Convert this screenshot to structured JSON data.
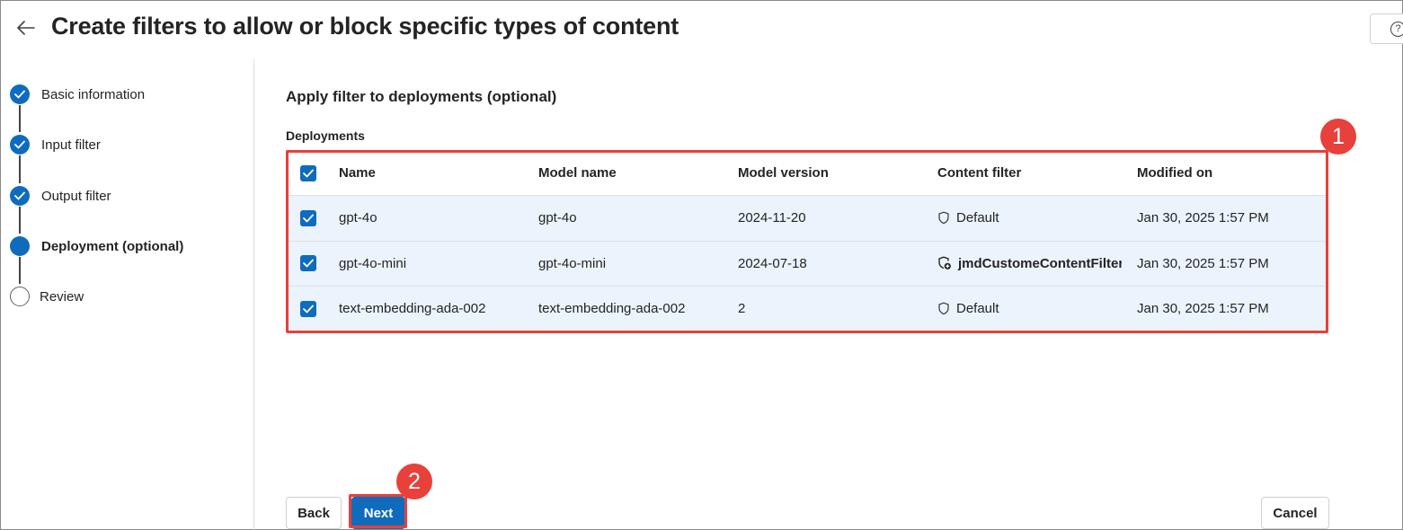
{
  "header": {
    "title": "Create filters to allow or block specific types of content",
    "help_symbol": "?"
  },
  "stepper": {
    "steps": [
      {
        "label": "Basic information",
        "state": "complete"
      },
      {
        "label": "Input filter",
        "state": "complete"
      },
      {
        "label": "Output filter",
        "state": "complete"
      },
      {
        "label": "Deployment (optional)",
        "state": "current"
      },
      {
        "label": "Review",
        "state": "pending"
      }
    ]
  },
  "main": {
    "section_title": "Apply filter to deployments (optional)",
    "table_label": "Deployments",
    "columns": [
      "Name",
      "Model name",
      "Model version",
      "Content filter",
      "Modified on"
    ],
    "rows": [
      {
        "name": "gpt-4o",
        "model": "gpt-4o",
        "version": "2024-11-20",
        "filter": "Default",
        "modified": "Jan 30, 2025 1:57 PM",
        "checked": true
      },
      {
        "name": "gpt-4o-mini",
        "model": "gpt-4o-mini",
        "version": "2024-07-18",
        "filter": "jmdCustomeContentFilter",
        "modified": "Jan 30, 2025 1:57 PM",
        "checked": true
      },
      {
        "name": "text-embedding-ada-002",
        "model": "text-embedding-ada-002",
        "version": "2",
        "filter": "Default",
        "modified": "Jan 30, 2025 1:57 PM",
        "checked": true
      }
    ]
  },
  "annotations": {
    "badge_1": "1",
    "badge_2": "2"
  },
  "footer": {
    "back_label": "Back",
    "next_label": "Next",
    "cancel_label": "Cancel"
  },
  "colors": {
    "accent": "#0f6cbd",
    "annotation": "#e8403a",
    "row_selected": "#ebf3fc"
  }
}
